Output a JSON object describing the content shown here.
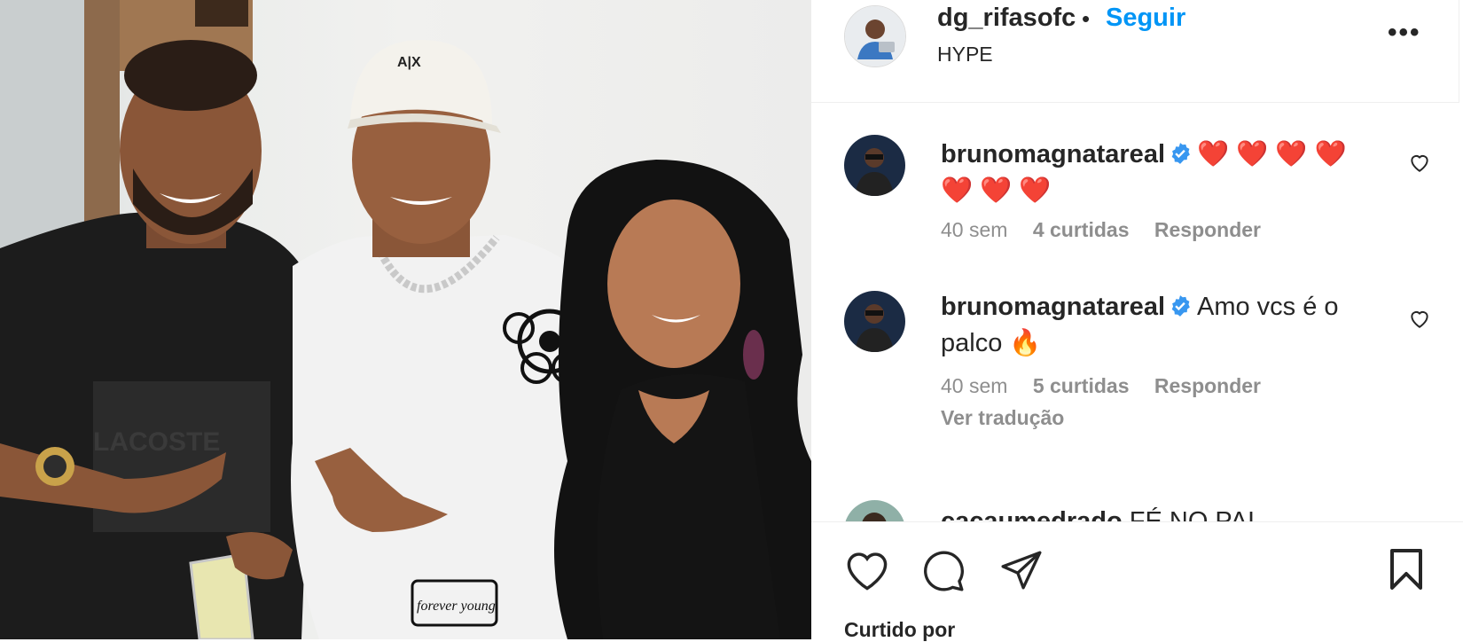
{
  "post": {
    "username": "dg_rifasofc",
    "separator": "•",
    "follow_label": "Seguir",
    "location": "HYPE",
    "more_label": "•••"
  },
  "photo": {
    "shirt_brand": "LACOSTE",
    "cap_brand": "A|X",
    "shirt_print": "forever young"
  },
  "comments": [
    {
      "username": "brunomagnatareal",
      "verified": true,
      "text": "❤️ ❤️ ❤️ ❤️ ❤️ ❤️ ❤️",
      "age": "40 sem",
      "likes": "4 curtidas",
      "reply": "Responder"
    },
    {
      "username": "brunomagnatareal",
      "verified": true,
      "text": "Amo vcs é o palco 🔥",
      "age": "40 sem",
      "likes": "5 curtidas",
      "reply": "Responder",
      "translate": "Ver tradução"
    },
    {
      "username": "cacaumedrado",
      "verified": false,
      "text": "FÉ NO PAI"
    }
  ],
  "footer": {
    "likes_peek": "Curtido por"
  },
  "colors": {
    "link": "#0095f6",
    "muted": "#8e8e8e",
    "text": "#262626",
    "verified": "#3897f0"
  }
}
